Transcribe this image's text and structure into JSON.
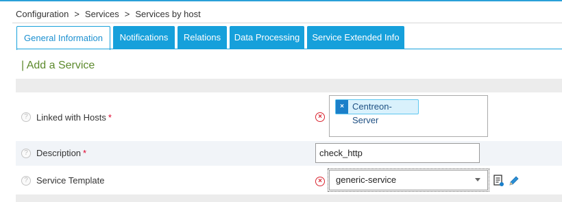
{
  "breadcrumb": {
    "items": [
      "Configuration",
      "Services",
      "Services by host"
    ],
    "separator": ">"
  },
  "tabs": [
    {
      "label": "General Information",
      "active": true
    },
    {
      "label": "Notifications",
      "active": false
    },
    {
      "label": "Relations",
      "active": false
    },
    {
      "label": "Data Processing",
      "active": false
    },
    {
      "label": "Service Extended Info",
      "active": false
    }
  ],
  "section_title": "| Add a Service",
  "form": {
    "linked_hosts": {
      "label": "Linked with Hosts",
      "required": "*",
      "chips": [
        "Centreon-Server"
      ],
      "chip_remove": "×"
    },
    "description": {
      "label": "Description",
      "required": "*",
      "value": "check_http"
    },
    "service_template": {
      "label": "Service Template",
      "selected": "generic-service"
    },
    "help_glyph": "?",
    "clear_glyph": "×"
  },
  "colors": {
    "accent": "#16a0db",
    "title_green": "#5d8a2d",
    "required_red": "#e0002a",
    "clear_red": "#d9232e"
  },
  "icons": [
    "help-icon",
    "clear-icon",
    "chip-remove-icon",
    "template-doc-icon",
    "edit-pencil-icon",
    "dropdown-arrow-icon"
  ]
}
